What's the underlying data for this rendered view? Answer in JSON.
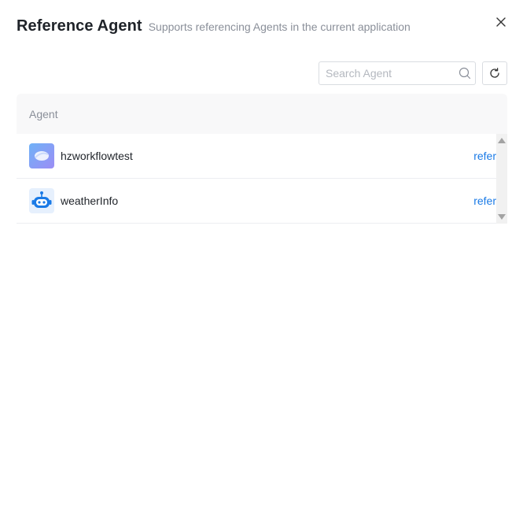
{
  "dialog": {
    "title": "Reference Agent",
    "subtitle": "Supports referencing Agents in the current application",
    "close_icon": "close-icon"
  },
  "toolbar": {
    "search_placeholder": "Search Agent",
    "search_value": "",
    "search_icon": "search-icon",
    "refresh_icon": "refresh-icon"
  },
  "table": {
    "columns": [
      "Agent"
    ],
    "rows": [
      {
        "name": "hzworkflowtest",
        "avatar_icon": "workflow-avatar-icon",
        "action": "refer"
      },
      {
        "name": "weatherInfo",
        "avatar_icon": "robot-avatar-icon",
        "action": "refer"
      }
    ]
  },
  "colors": {
    "accent": "#1a7ae6",
    "header_bg": "#f8f8f9",
    "muted_text": "#8a8f99"
  }
}
